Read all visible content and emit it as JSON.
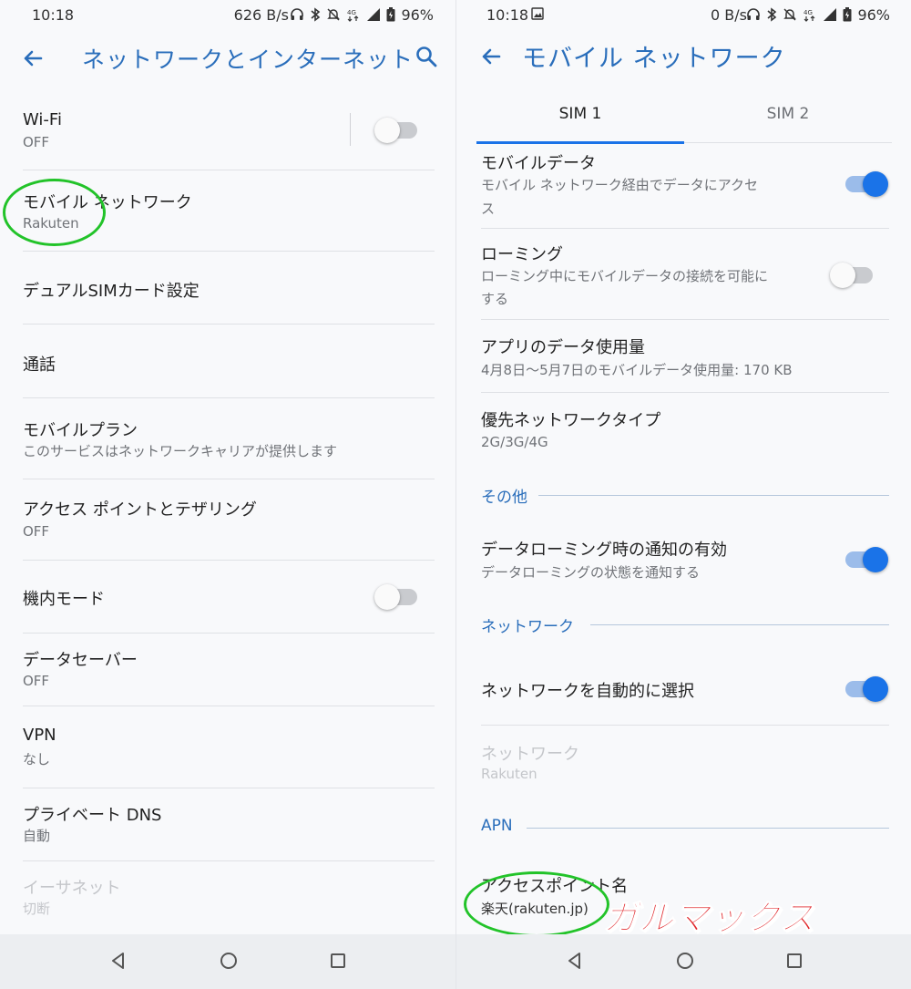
{
  "left": {
    "status": {
      "time": "10:18",
      "speed": "626 B/s",
      "battery": "96%"
    },
    "title": "ネットワークとインターネット",
    "items": [
      {
        "title": "Wi-Fi",
        "sub": "OFF"
      },
      {
        "title": "モバイル ネットワーク",
        "sub": "Rakuten"
      },
      {
        "title": "デュアルSIMカード設定"
      },
      {
        "title": "通話"
      },
      {
        "title": "モバイルプラン",
        "sub": "このサービスはネットワークキャリアが提供します"
      },
      {
        "title": "アクセス ポイントとテザリング",
        "sub": "OFF"
      },
      {
        "title": "機内モード"
      },
      {
        "title": "データセーバー",
        "sub": "OFF"
      },
      {
        "title": "VPN",
        "sub": "なし"
      },
      {
        "title": "プライベート DNS",
        "sub": "自動"
      },
      {
        "title": "イーサネット",
        "sub": "切断"
      }
    ],
    "toggles": {
      "wifi": false,
      "airplane": false
    }
  },
  "right": {
    "status": {
      "time": "10:18",
      "speed": "0 B/s",
      "battery": "96%"
    },
    "title": "モバイル ネットワーク",
    "tabs": [
      "SIM 1",
      "SIM 2"
    ],
    "items": [
      {
        "title": "モバイルデータ",
        "sub": "モバイル ネットワーク経由でデータにアクセ",
        "sub2": "ス"
      },
      {
        "title": "ローミング",
        "sub": "ローミング中にモバイルデータの接続を可能に",
        "sub2": "する"
      },
      {
        "title": "アプリのデータ使用量",
        "sub": "4月8日～5月7日のモバイルデータ使用量: 170 KB"
      },
      {
        "title": "優先ネットワークタイプ",
        "sub": "2G/3G/4G"
      },
      {
        "title": "データローミング時の通知の有効",
        "sub": "データローミングの状態を通知する"
      },
      {
        "title": "ネットワークを自動的に選択"
      },
      {
        "title": "ネットワーク",
        "sub": "Rakuten"
      },
      {
        "title": "アクセスポイント名",
        "sub": "楽天(rakuten.jp)"
      }
    ],
    "sections": [
      "その他",
      "ネットワーク",
      "APN"
    ],
    "toggles": {
      "mobile_data": true,
      "roaming": false,
      "roaming_notify": true,
      "auto_select": true
    }
  },
  "watermark": "ガルマックス",
  "colors": {
    "accent": "#1a73e8",
    "title": "#2a6ebb",
    "highlight_circle": "#22c329",
    "watermark": "#e0262b"
  }
}
